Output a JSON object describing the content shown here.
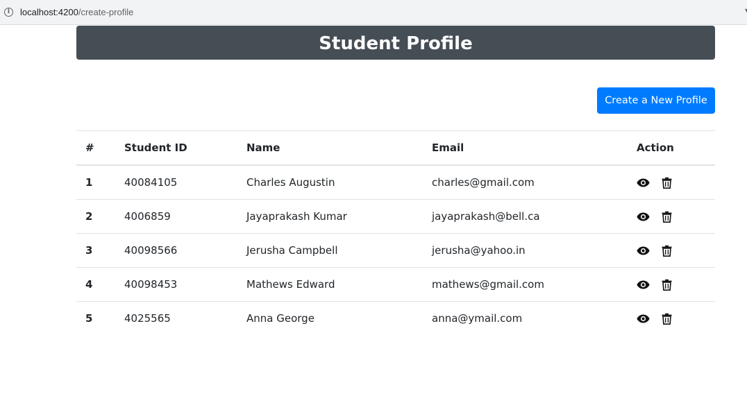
{
  "browser": {
    "url_host": "localhost:4200",
    "url_path": "/create-profile"
  },
  "page": {
    "title": "Student Profile",
    "create_button_label": "Create a New Profile"
  },
  "table": {
    "headers": {
      "index": "#",
      "student_id": "Student ID",
      "name": "Name",
      "email": "Email",
      "action": "Action"
    },
    "rows": [
      {
        "index": "1",
        "student_id": "40084105",
        "name": "Charles Augustin",
        "email": "charles@gmail.com"
      },
      {
        "index": "2",
        "student_id": "4006859",
        "name": "Jayaprakash Kumar",
        "email": "jayaprakash@bell.ca"
      },
      {
        "index": "3",
        "student_id": "40098566",
        "name": "Jerusha Campbell",
        "email": "jerusha@yahoo.in"
      },
      {
        "index": "4",
        "student_id": "40098453",
        "name": "Mathews Edward",
        "email": "mathews@gmail.com"
      },
      {
        "index": "5",
        "student_id": "4025565",
        "name": "Anna George",
        "email": "anna@ymail.com"
      }
    ],
    "row_actions": [
      "view-icon",
      "delete-icon"
    ]
  },
  "colors": {
    "header_bar": "#454d55",
    "primary_button": "#007bff"
  }
}
